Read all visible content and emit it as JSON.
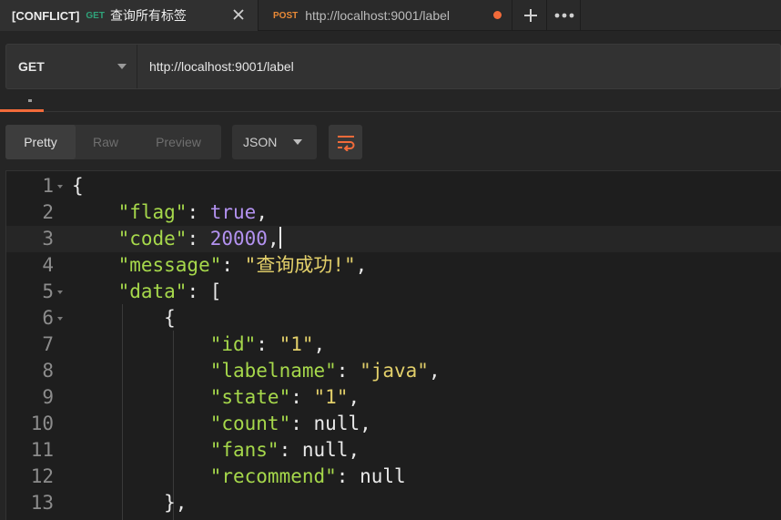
{
  "tabs": [
    {
      "conflict": "[CONFLICT]",
      "method": "GET",
      "title": "查询所有标签"
    },
    {
      "method": "POST",
      "url": "http://localhost:9001/label"
    }
  ],
  "request": {
    "method": "GET",
    "url": "http://localhost:9001/label"
  },
  "response": {
    "view_modes": [
      "Pretty",
      "Raw",
      "Preview"
    ],
    "active_view": "Pretty",
    "format": "JSON"
  },
  "editor": {
    "line_numbers": [
      "1",
      "2",
      "3",
      "4",
      "5",
      "6",
      "7",
      "8",
      "9",
      "10",
      "11",
      "12",
      "13"
    ],
    "lines": {
      "l1": {
        "brace": "{"
      },
      "l2": {
        "key": "\"flag\"",
        "value": "true"
      },
      "l3": {
        "key": "\"code\"",
        "value": "20000"
      },
      "l4": {
        "key": "\"message\"",
        "value": "\"查询成功!\""
      },
      "l5": {
        "key": "\"data\"",
        "value": "["
      },
      "l6": {
        "brace": "{"
      },
      "l7": {
        "key": "\"id\"",
        "value": "\"1\""
      },
      "l8": {
        "key": "\"labelname\"",
        "value": "\"java\""
      },
      "l9": {
        "key": "\"state\"",
        "value": "\"1\""
      },
      "l10": {
        "key": "\"count\"",
        "value": "null"
      },
      "l11": {
        "key": "\"fans\"",
        "value": "null"
      },
      "l12": {
        "key": "\"recommend\"",
        "value": "null"
      },
      "l13": {
        "brace": "},"
      }
    }
  },
  "colors": {
    "accent": "#f26b3a",
    "get_method": "#2fa37a",
    "post_method": "#e98a37",
    "json_key": "#a6d84b",
    "json_string": "#e2cf6a",
    "json_literal": "#b392f0"
  }
}
